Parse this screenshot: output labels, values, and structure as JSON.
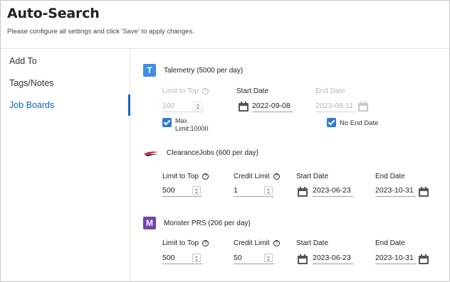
{
  "header": {
    "title": "Auto-Search",
    "subtitle": "Please configure all settings and click 'Save' to apply changes."
  },
  "sidebar": {
    "items": [
      {
        "label": "Add To",
        "active": false
      },
      {
        "label": "Tags/Notes",
        "active": false
      },
      {
        "label": "Job Boards",
        "active": true
      }
    ]
  },
  "boards": {
    "telemetry": {
      "name": "Talemetry (5000 per day)",
      "logo_letter": "T",
      "limit_label": "Limit to Top",
      "limit_value": "100",
      "start_label": "Start Date",
      "start_value": "2022-09-08",
      "end_label": "End Date",
      "end_value": "2023-08-11",
      "max_label_line1": "Max",
      "max_label_line2": "Limit:10000",
      "no_end_label": "No End Date"
    },
    "clearance": {
      "name": "ClearanceJobs (600 per day)",
      "limit_label": "Limit to Top",
      "limit_value": "500",
      "credit_label": "Credit Limit",
      "credit_value": "1",
      "start_label": "Start Date",
      "start_value": "2023-06-23",
      "end_label": "End Date",
      "end_value": "2023-10-31"
    },
    "monster": {
      "name": "Monster PRS (206 per day)",
      "logo_letter": "M",
      "limit_label": "Limit to Top",
      "limit_value": "500",
      "credit_label": "Credit Limit",
      "credit_value": "50",
      "start_label": "Start Date",
      "start_value": "2023-06-23",
      "end_label": "End Date",
      "end_value": "2023-10-31"
    }
  },
  "colors": {
    "accent": "#1565c0",
    "checkbox": "#2e7bd6",
    "telemetry_logo": "#3d8ee6",
    "monster_logo": "#6e46ae",
    "clearance_logo_red": "#d32f2f",
    "clearance_logo_navy": "#1a2a5a"
  }
}
